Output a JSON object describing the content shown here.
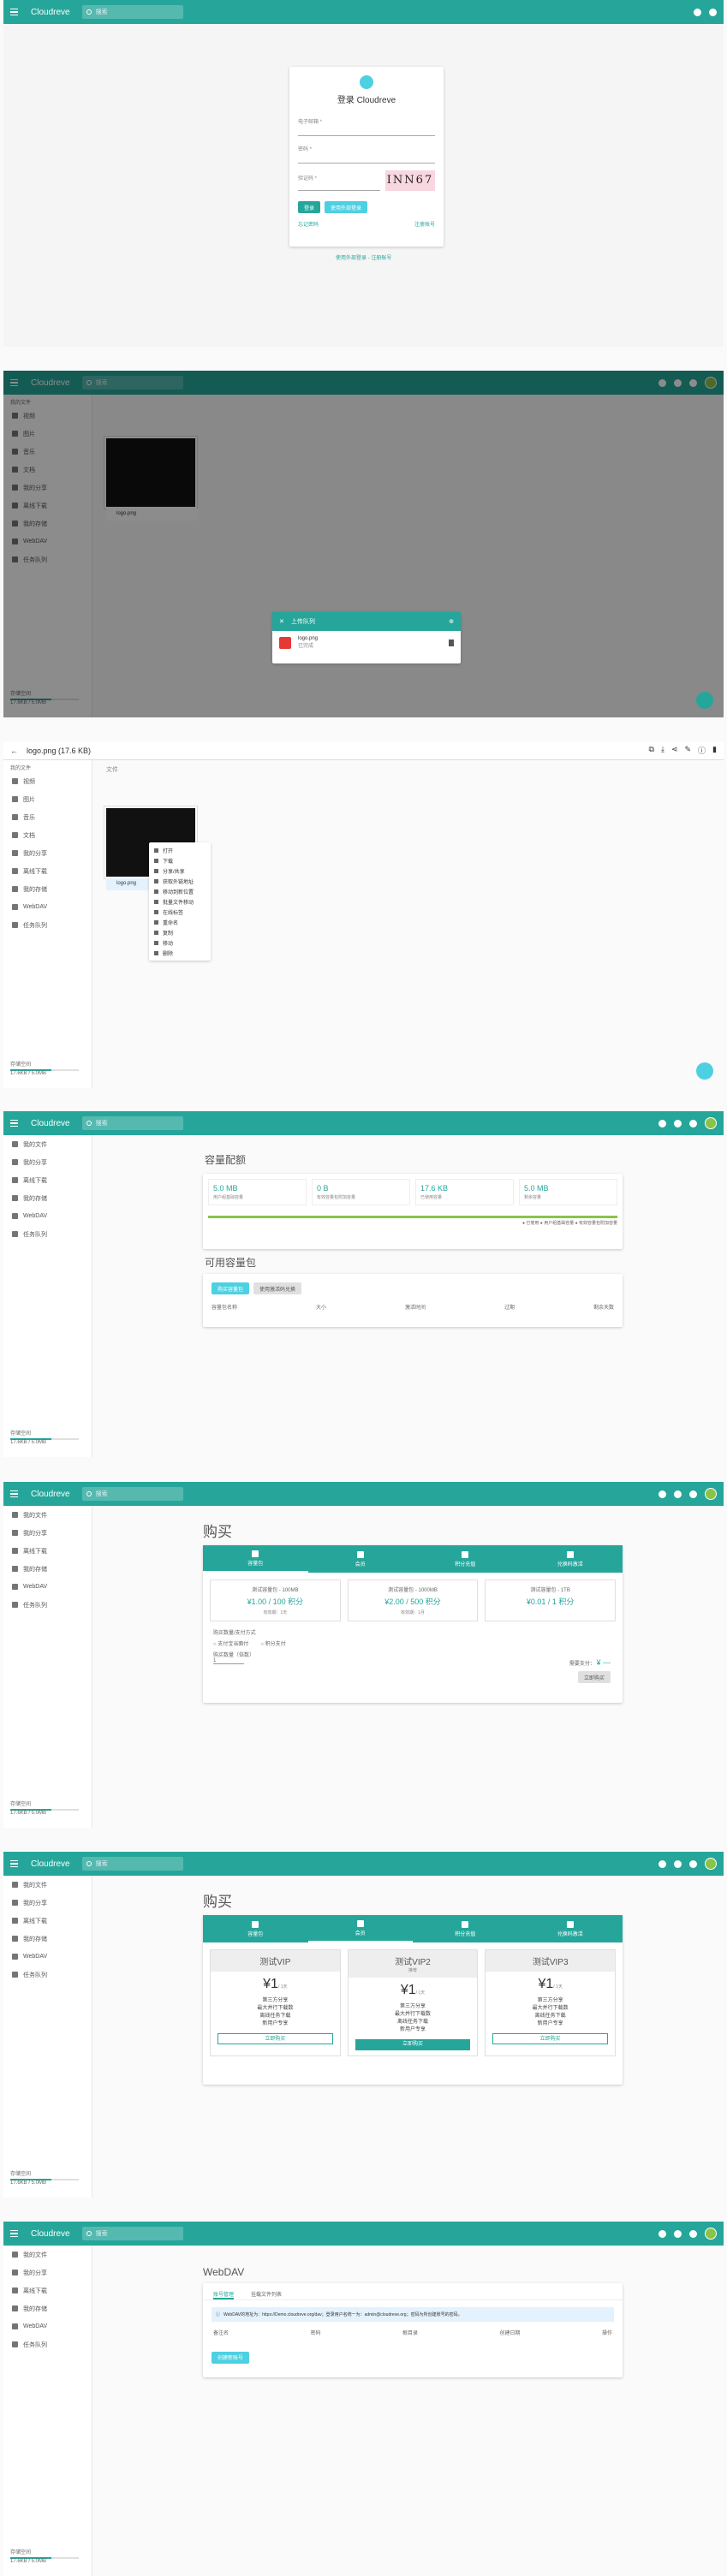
{
  "brand": "Cloudreve",
  "search_placeholder": "搜索",
  "sidebar": {
    "items": [
      "我的文件",
      "视频",
      "图片",
      "音乐",
      "文档",
      "我的分享",
      "离线下载",
      "我的存储",
      "WebDAV",
      "任务队列"
    ],
    "storage_label": "存储空间",
    "storage_value": "17.6KB / 5.0MB"
  },
  "login": {
    "title": "登录 Cloudreve",
    "email_label": "电子邮箱 *",
    "password_label": "密码 *",
    "captcha_label": "验证码 *",
    "captcha_text": "INN67",
    "login_button": "登录",
    "register_button": "使用外部登录",
    "forgot": "忘记密码",
    "signup": "注册账号",
    "footer_link": "使用外部登录 - 注册账号"
  },
  "files": {
    "breadcrumb": "我的文件",
    "section": "文件",
    "file_name": "logo.png"
  },
  "upload": {
    "title": "上传队列",
    "file": "logo.png",
    "status": "已完成"
  },
  "preview": {
    "title": "logo.png (17.6 KB)"
  },
  "context_menu": [
    "打开",
    "下载",
    "分享/共享",
    "获取外链地址",
    "移动到新位置",
    "批量文件移动",
    "在线标签",
    "重命名",
    "复制",
    "移动",
    "删除"
  ],
  "quota": {
    "title": "容量配额",
    "cards": [
      {
        "value": "5.0 MB",
        "label": "用户组基础容量"
      },
      {
        "value": "0 B",
        "label": "有效容量包附加容量"
      },
      {
        "value": "17.6 KB",
        "label": "已使用容量"
      },
      {
        "value": "5.0 MB",
        "label": "剩余容量"
      }
    ],
    "legend": "● 已使用  ● 用户组基础容量  ● 有效容量包附加容量",
    "packs_title": "可用容量包",
    "buy_button": "购买容量包",
    "redeem_button": "使用激活码兑换",
    "columns": [
      "容量包名称",
      "大小",
      "激活时间",
      "过期",
      "剩余天数"
    ]
  },
  "shop": {
    "title": "购买",
    "tabs": [
      "容量包",
      "会员",
      "积分充值",
      "兑换码激活"
    ],
    "packs": [
      {
        "name": "测试容量包 - 100MB",
        "price": "¥1.00 / 100 积分",
        "period": "有效期：1天"
      },
      {
        "name": "测试容量包 - 1000MB",
        "price": "¥2.00 / 500 积分",
        "period": "有效期：1月"
      },
      {
        "name": "测试容量包 - 1TB",
        "price": "¥0.01 / 1 积分",
        "period": ""
      }
    ],
    "pay_label": "购买数量/支付方式",
    "pay_options": [
      "支付宝当面付",
      "积分支付"
    ],
    "qty_label": "购买数量（倍数）",
    "qty": "1",
    "total_label": "需要支付：",
    "total": "¥ ---",
    "buy_button": "立即购买"
  },
  "vip": {
    "title": "购买",
    "plans": [
      {
        "name": "测试VIP",
        "sub": "",
        "price": "¥1",
        "unit": "/ 1天",
        "features": [
          "第三方分享",
          "最大并行下载数",
          "离线任务下载",
          "新用户专享"
        ],
        "button": "立即购买"
      },
      {
        "name": "测试VIP2",
        "sub": "推荐",
        "price": "¥1",
        "unit": "/ 1天",
        "features": [
          "第三方分享",
          "最大并行下载数",
          "离线任务下载",
          "新用户专享"
        ],
        "button": "立即购买"
      },
      {
        "name": "测试VIP3",
        "sub": "",
        "price": "¥1",
        "unit": "/ 1天",
        "features": [
          "第三方分享",
          "最大并行下载数",
          "离线任务下载",
          "新用户专享"
        ],
        "button": "立即购买"
      }
    ]
  },
  "webdav": {
    "title": "WebDAV",
    "tabs": [
      "账号管理",
      "挂载文件列表"
    ],
    "info": "WebDAV的地址为：https://Demo.cloudreve.org/dav；登录用户名统一为：admin@cloudreve.org；密码为所创建账号的密码。",
    "columns": [
      "备注名",
      "密码",
      "根目录",
      "创建日期",
      "操作"
    ],
    "create_button": "创建新账号"
  },
  "colors": {
    "primary": "#26a69a",
    "accent": "#4dd0e1"
  }
}
